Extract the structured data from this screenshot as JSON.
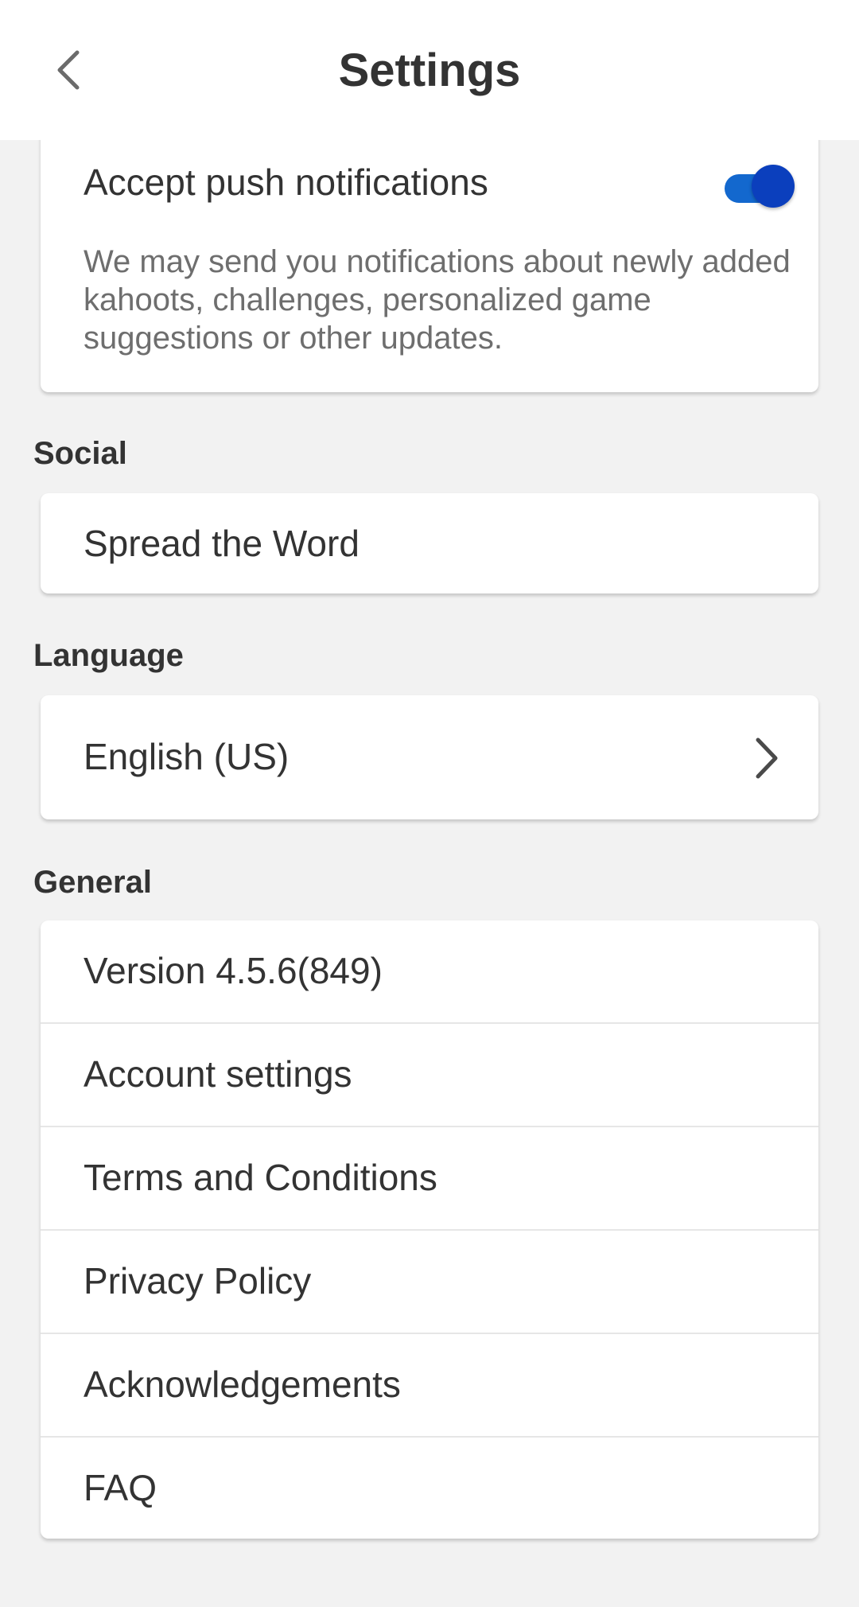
{
  "header": {
    "title": "Settings"
  },
  "notifications": {
    "title": "Accept push notifications",
    "enabled": true,
    "description": "We may send you notifications about newly added kahoots, challenges, personalized game suggestions or other updates."
  },
  "social": {
    "label": "Social",
    "items": [
      {
        "label": "Spread the Word"
      }
    ]
  },
  "language": {
    "label": "Language",
    "value": "English (US)"
  },
  "general": {
    "label": "General",
    "items": [
      {
        "label": "Version 4.5.6(849)"
      },
      {
        "label": "Account settings"
      },
      {
        "label": "Terms and Conditions"
      },
      {
        "label": "Privacy Policy"
      },
      {
        "label": "Acknowledgements"
      },
      {
        "label": "FAQ"
      }
    ]
  },
  "colors": {
    "toggle_track": "#1368ce",
    "toggle_knob": "#0b3fbd",
    "background": "#f2f2f2"
  }
}
